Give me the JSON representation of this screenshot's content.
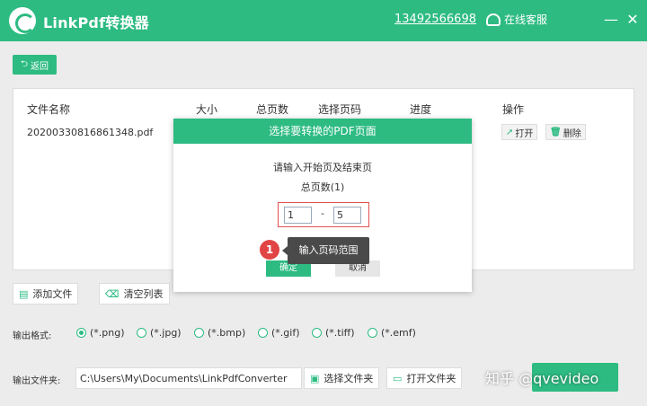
{
  "window": {
    "app_title": "LinkPdf转换器",
    "phone": "13492566698",
    "service_label": "在线客服",
    "minimize": "—",
    "close": "✕"
  },
  "toolbar": {
    "back_label": "返回"
  },
  "table": {
    "columns": [
      "文件名称",
      "大小",
      "总页数",
      "选择页码",
      "进度",
      "操作"
    ],
    "rows": [
      {
        "filename": "20200330816861348.pdf",
        "open_label": "打开",
        "delete_label": "删除"
      }
    ]
  },
  "actions": {
    "add_file": "添加文件",
    "clear_list": "清空列表"
  },
  "format": {
    "label": "输出格式:",
    "options": [
      "(*.png)",
      "(*.jpg)",
      "(*.bmp)",
      "(*.gif)",
      "(*.tiff)",
      "(*.emf)"
    ],
    "selected": "(*.png)"
  },
  "output": {
    "label": "输出文件夹:",
    "path": "C:\\Users\\My\\Documents\\LinkPdfConverter",
    "choose_folder": "选择文件夹",
    "open_folder": "打开文件夹"
  },
  "dialog": {
    "title": "选择要转换的PDF页面",
    "prompt": "请输入开始页及结束页",
    "total_pages": "总页数(1)",
    "start_page": "1",
    "separator": "-",
    "end_page": "5",
    "ok": "确定",
    "cancel": "取消"
  },
  "tooltip": {
    "badge": "1",
    "text": "输入页码范围"
  },
  "watermark": {
    "text": "知乎 @qvevideo"
  },
  "colors": {
    "accent": "#2dbb82",
    "danger": "#e04444"
  }
}
